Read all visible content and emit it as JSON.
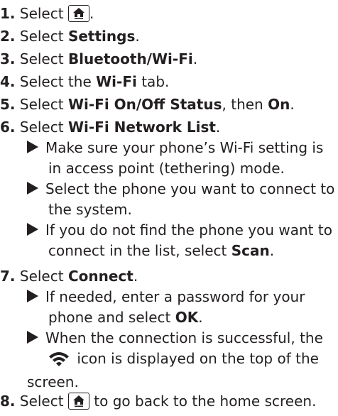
{
  "icons": {
    "home": "home-icon",
    "wifi": "wifi-icon"
  },
  "steps": [
    {
      "num": "1.",
      "pre": "Select ",
      "post": "."
    },
    {
      "num": "2.",
      "pre": "Select ",
      "bold": "Settings",
      "post": "."
    },
    {
      "num": "3.",
      "pre": "Select ",
      "bold": "Bluetooth/Wi-Fi",
      "post": "."
    },
    {
      "num": "4.",
      "pre": "Select the ",
      "bold": "Wi-Fi",
      "post": " tab."
    },
    {
      "num": "5.",
      "pre": "Select ",
      "bold": "Wi-Fi On/Off Status",
      "mid": ", then ",
      "bold2": "On",
      "post": "."
    },
    {
      "num": "6.",
      "pre": "Select ",
      "bold": "Wi-Fi Network List",
      "post": "."
    },
    {
      "num": "7.",
      "pre": "Select ",
      "bold": "Connect",
      "post": "."
    },
    {
      "num": "8.",
      "pre": "Select ",
      "post": " to go back to the home screen."
    }
  ],
  "step6_notes": [
    {
      "l1": "Make sure your phone’s Wi-Fi setting is",
      "l2": "in access point (tethering) mode."
    },
    {
      "l1": "Select the phone you want to connect to",
      "l2": "the system."
    },
    {
      "l1": "If you do not find the phone you want to",
      "l2": "connect in the list, select ",
      "bold": "Scan",
      "post": "."
    }
  ],
  "step7_notes": [
    {
      "l1": "If needed, enter a password for your",
      "l2": "phone and select ",
      "bold": "OK",
      "post": "."
    },
    {
      "l1": "When the connection is successful, the",
      "l2b": " icon is displayed on the top of the",
      "l3": "screen."
    }
  ]
}
